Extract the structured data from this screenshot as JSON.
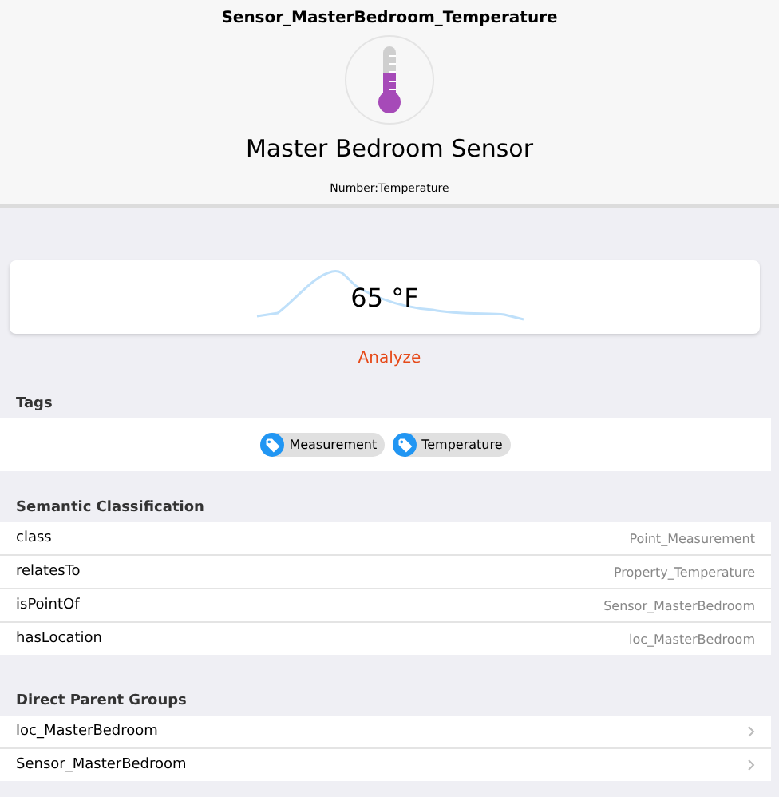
{
  "header": {
    "item_name": "Sensor_MasterBedroom_Temperature",
    "label": "Master Bedroom Sensor",
    "type": "Number:Temperature"
  },
  "state_card": {
    "value": "65 °F"
  },
  "analyze_link": "Analyze",
  "tags": {
    "title": "Tags",
    "items": [
      "Measurement",
      "Temperature"
    ]
  },
  "semantic": {
    "title": "Semantic Classification",
    "rows": [
      {
        "key": "class",
        "value": "Point_Measurement"
      },
      {
        "key": "relatesTo",
        "value": "Property_Temperature"
      },
      {
        "key": "isPointOf",
        "value": "Sensor_MasterBedroom"
      },
      {
        "key": "hasLocation",
        "value": "loc_MasterBedroom"
      }
    ]
  },
  "parent_groups": {
    "title": "Direct Parent Groups",
    "items": [
      "loc_MasterBedroom",
      "Sensor_MasterBedroom"
    ]
  }
}
